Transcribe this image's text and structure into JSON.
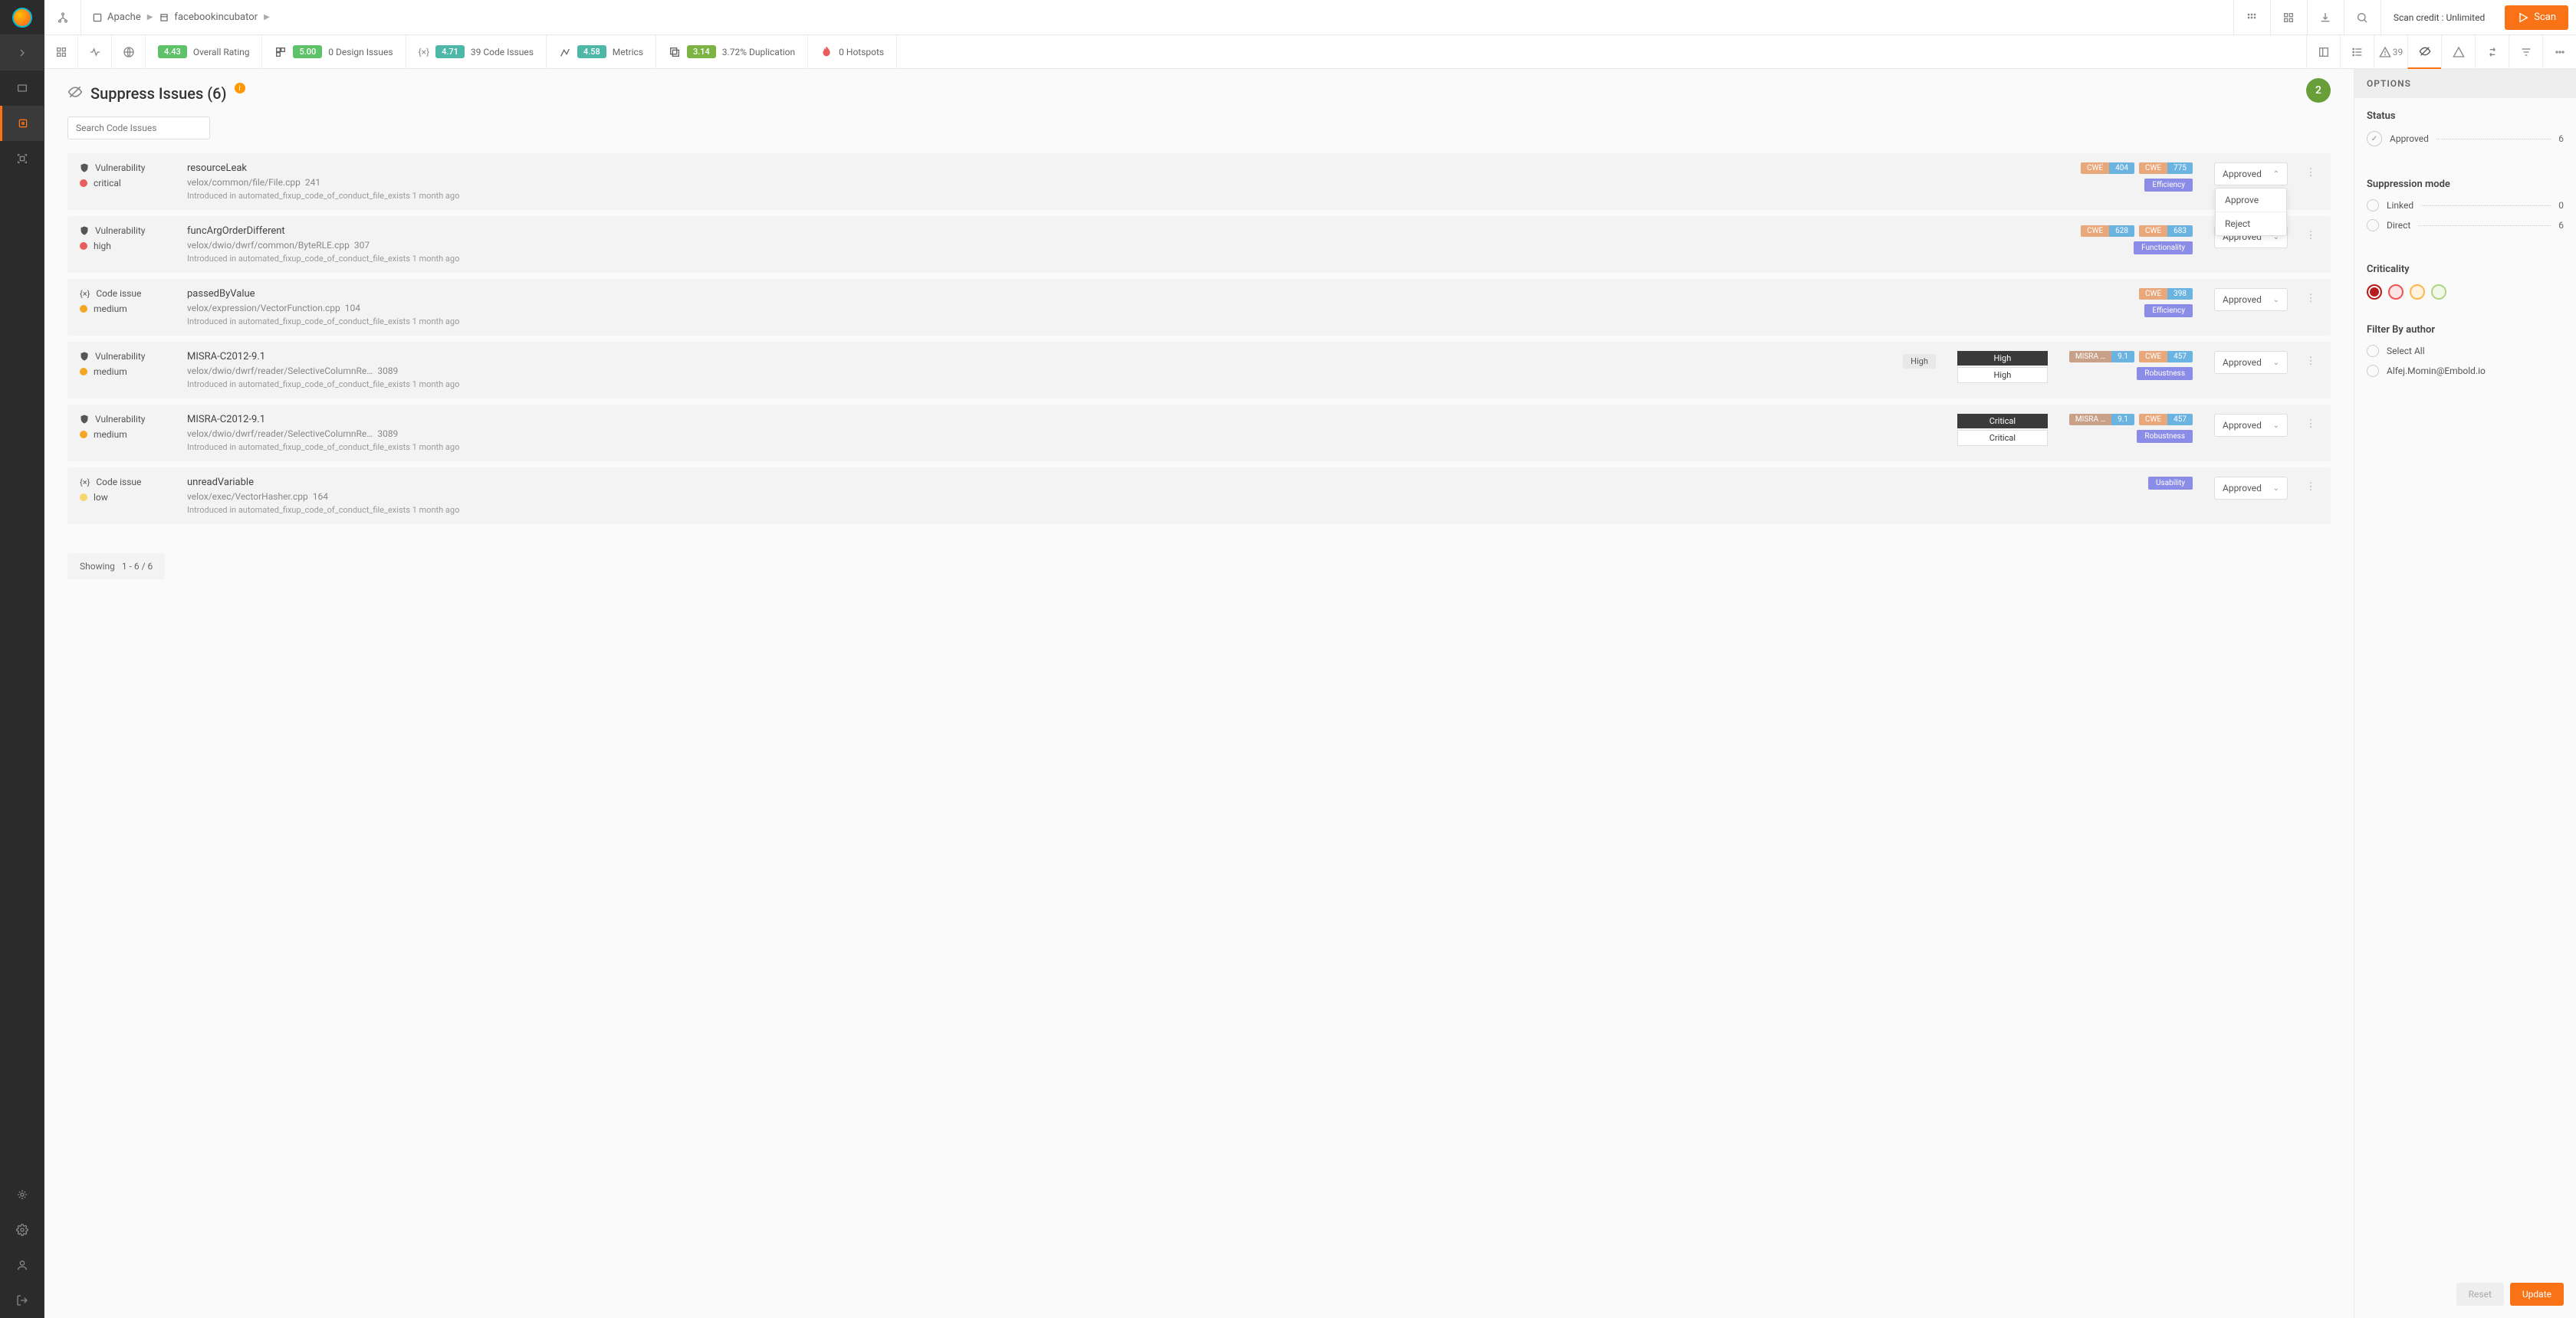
{
  "breadcrumb": {
    "org": "Apache",
    "repo": "facebookincubator"
  },
  "scan_credit": "Scan credit : Unlimited",
  "scan_btn": "Scan",
  "metrics": {
    "overall": {
      "score": "4.43",
      "label": "Overall Rating"
    },
    "design": {
      "score": "5.00",
      "label": "0 Design Issues"
    },
    "code": {
      "score": "4.71",
      "label": "39 Code Issues"
    },
    "metrics": {
      "score": "4.58",
      "label": "Metrics"
    },
    "dup": {
      "score": "3.14",
      "label": "3.72% Duplication"
    },
    "hotspots": {
      "label": "0 Hotspots"
    },
    "warn_count": "39"
  },
  "page": {
    "title": "Suppress Issues (6)",
    "search_placeholder": "Search Code Issues",
    "step": "2"
  },
  "dropdown": {
    "approve": "Approve",
    "reject": "Reject"
  },
  "issues": [
    {
      "type": "Vulnerability",
      "severity": "critical",
      "name": "resourceLeak",
      "path": "velox/common/file/File.cpp",
      "line": "241",
      "intro": "Introduced in automated_fixup_code_of_conduct_file_exists 1 month ago",
      "cwes": [
        {
          "k": "CWE",
          "v": "404"
        },
        {
          "k": "CWE",
          "v": "775"
        }
      ],
      "cat": "Efficiency",
      "status": "Approved",
      "open": true
    },
    {
      "type": "Vulnerability",
      "severity": "high",
      "name": "funcArgOrderDifferent",
      "path": "velox/dwio/dwrf/common/ByteRLE.cpp",
      "line": "307",
      "intro": "Introduced in automated_fixup_code_of_conduct_file_exists 1 month ago",
      "cwes": [
        {
          "k": "CWE",
          "v": "628"
        },
        {
          "k": "CWE",
          "v": "683"
        }
      ],
      "cat": "Functionality",
      "status": "Approved"
    },
    {
      "type": "Code issue",
      "severity": "medium",
      "name": "passedByValue",
      "path": "velox/expression/VectorFunction.cpp",
      "line": "104",
      "intro": "Introduced in automated_fixup_code_of_conduct_file_exists 1 month ago",
      "cwes": [
        {
          "k": "CWE",
          "v": "398"
        }
      ],
      "cat": "Efficiency",
      "status": "Approved"
    },
    {
      "type": "Vulnerability",
      "severity": "medium",
      "name": "MISRA-C2012-9.1",
      "path": "velox/dwio/dwrf/reader/SelectiveColumnRe…",
      "line": "3089",
      "intro": "Introduced in automated_fixup_code_of_conduct_file_exists 1 month ago",
      "hint": "High",
      "sev_pills": [
        "High",
        "High"
      ],
      "cwes": [
        {
          "k": "MISRA …",
          "v": "9.1",
          "misra": true
        },
        {
          "k": "CWE",
          "v": "457"
        }
      ],
      "cat": "Robustness",
      "status": "Approved"
    },
    {
      "type": "Vulnerability",
      "severity": "medium",
      "name": "MISRA-C2012-9.1",
      "path": "velox/dwio/dwrf/reader/SelectiveColumnRe…",
      "line": "3089",
      "intro": "Introduced in automated_fixup_code_of_conduct_file_exists 1 month ago",
      "sev_pills": [
        "Critical",
        "Critical"
      ],
      "cwes": [
        {
          "k": "MISRA …",
          "v": "9.1",
          "misra": true
        },
        {
          "k": "CWE",
          "v": "457"
        }
      ],
      "cat": "Robustness",
      "status": "Approved"
    },
    {
      "type": "Code issue",
      "severity": "low",
      "name": "unreadVariable",
      "path": "velox/exec/VectorHasher.cpp",
      "line": "164",
      "intro": "Introduced in automated_fixup_code_of_conduct_file_exists 1 month ago",
      "cat": "Usability",
      "status": "Approved"
    }
  ],
  "pager": {
    "label": "Showing",
    "range": "1 - 6 / 6"
  },
  "options": {
    "header": "OPTIONS",
    "status_label": "Status",
    "status_items": [
      {
        "label": "Approved",
        "count": "6"
      }
    ],
    "supp_label": "Suppression mode",
    "supp_items": [
      {
        "label": "Linked",
        "count": "0"
      },
      {
        "label": "Direct",
        "count": "6"
      }
    ],
    "crit_label": "Criticality",
    "author_label": "Filter By author",
    "select_all": "Select All",
    "authors": [
      "Alfej.Momin@Embold.io"
    ],
    "reset": "Reset",
    "update": "Update"
  }
}
